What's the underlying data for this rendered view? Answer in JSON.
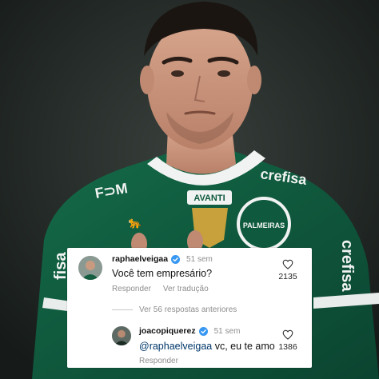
{
  "comments": [
    {
      "username": "raphaelveigaa",
      "verified": true,
      "age": "51 sem",
      "text": "Você tem empresário?",
      "reply_label": "Responder",
      "translate_label": "Ver tradução",
      "likes": "2135"
    },
    {
      "username": "joacopiquerez",
      "verified": true,
      "age": "51 sem",
      "mention": "@raphaelveigaa",
      "text": " vc, eu te amo",
      "reply_label": "Responder",
      "likes": "1386"
    }
  ],
  "replies_toggle": "Ver 56 respostas anteriores",
  "photo": {
    "shirt_brand": "crefisa",
    "shirt_logo": "PALMEIRAS",
    "shirt_sponsor": "AVANTI",
    "colors": {
      "shirt": "#0f5a3e",
      "background": "#1f2523",
      "verified": "#3897f0"
    }
  }
}
